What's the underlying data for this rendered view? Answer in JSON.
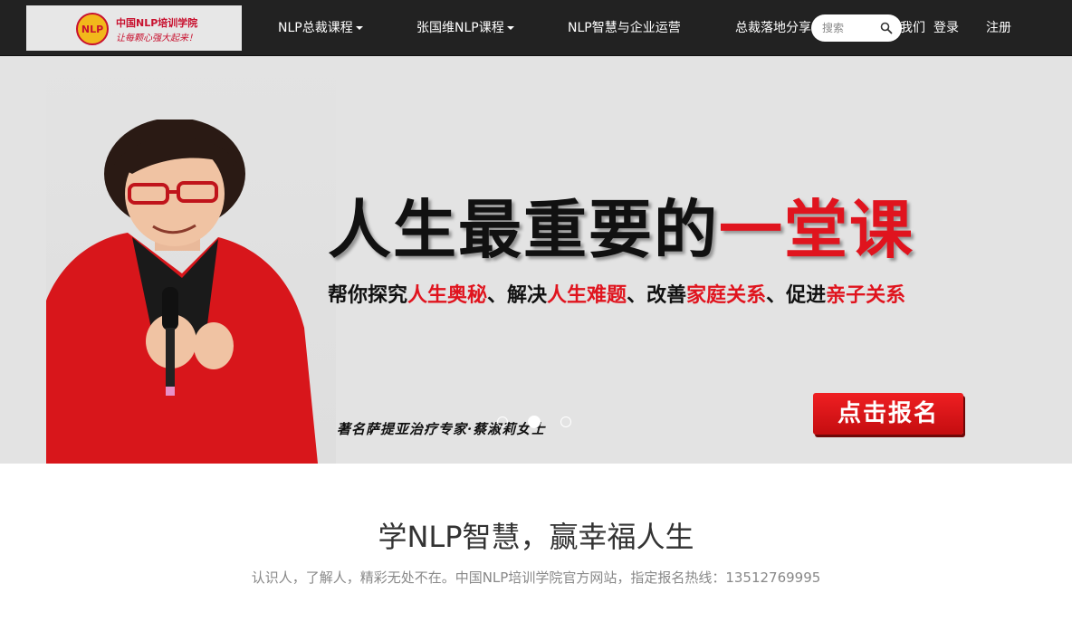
{
  "logo": {
    "emblem_text": "NLP",
    "name": "中国NLP培训学院",
    "slogan": "让每颗心强大起来！"
  },
  "nav": {
    "items": [
      {
        "label": "NLP总裁课程",
        "has_dropdown": true
      },
      {
        "label": "张国维NLP课程",
        "has_dropdown": true
      },
      {
        "label": "NLP智慧与企业运营",
        "has_dropdown": false
      },
      {
        "label": "总裁落地分享",
        "has_dropdown": false
      }
    ],
    "about_label": "我们",
    "login_label": "登录",
    "register_label": "注册"
  },
  "search": {
    "placeholder": "搜索",
    "value": ""
  },
  "banner": {
    "headline_dark": "人生最重要的",
    "headline_red": "一堂课",
    "sub_parts": [
      {
        "text": "帮你探究",
        "highlight": false
      },
      {
        "text": "人生奥秘",
        "highlight": true
      },
      {
        "text": "、解决",
        "highlight": false
      },
      {
        "text": "人生难题",
        "highlight": true
      },
      {
        "text": "、改善",
        "highlight": false
      },
      {
        "text": "家庭关系",
        "highlight": true
      },
      {
        "text": "、促进",
        "highlight": false
      },
      {
        "text": "亲子关系",
        "highlight": true
      }
    ],
    "caption": "著名萨提亚治疗专家·蔡淑莉女士",
    "cta_label": "点击报名",
    "slide_count": 3,
    "active_slide": 2
  },
  "intro": {
    "title": "学NLP智慧，赢幸福人生",
    "subtitle": "认识人，了解人，精彩无处不在。中国NLP培训学院官方网站，指定报名热线：13512769995"
  },
  "colors": {
    "nav_bg": "#222222",
    "accent_red": "#e0141e",
    "banner_bg": "#e3e3e3"
  }
}
